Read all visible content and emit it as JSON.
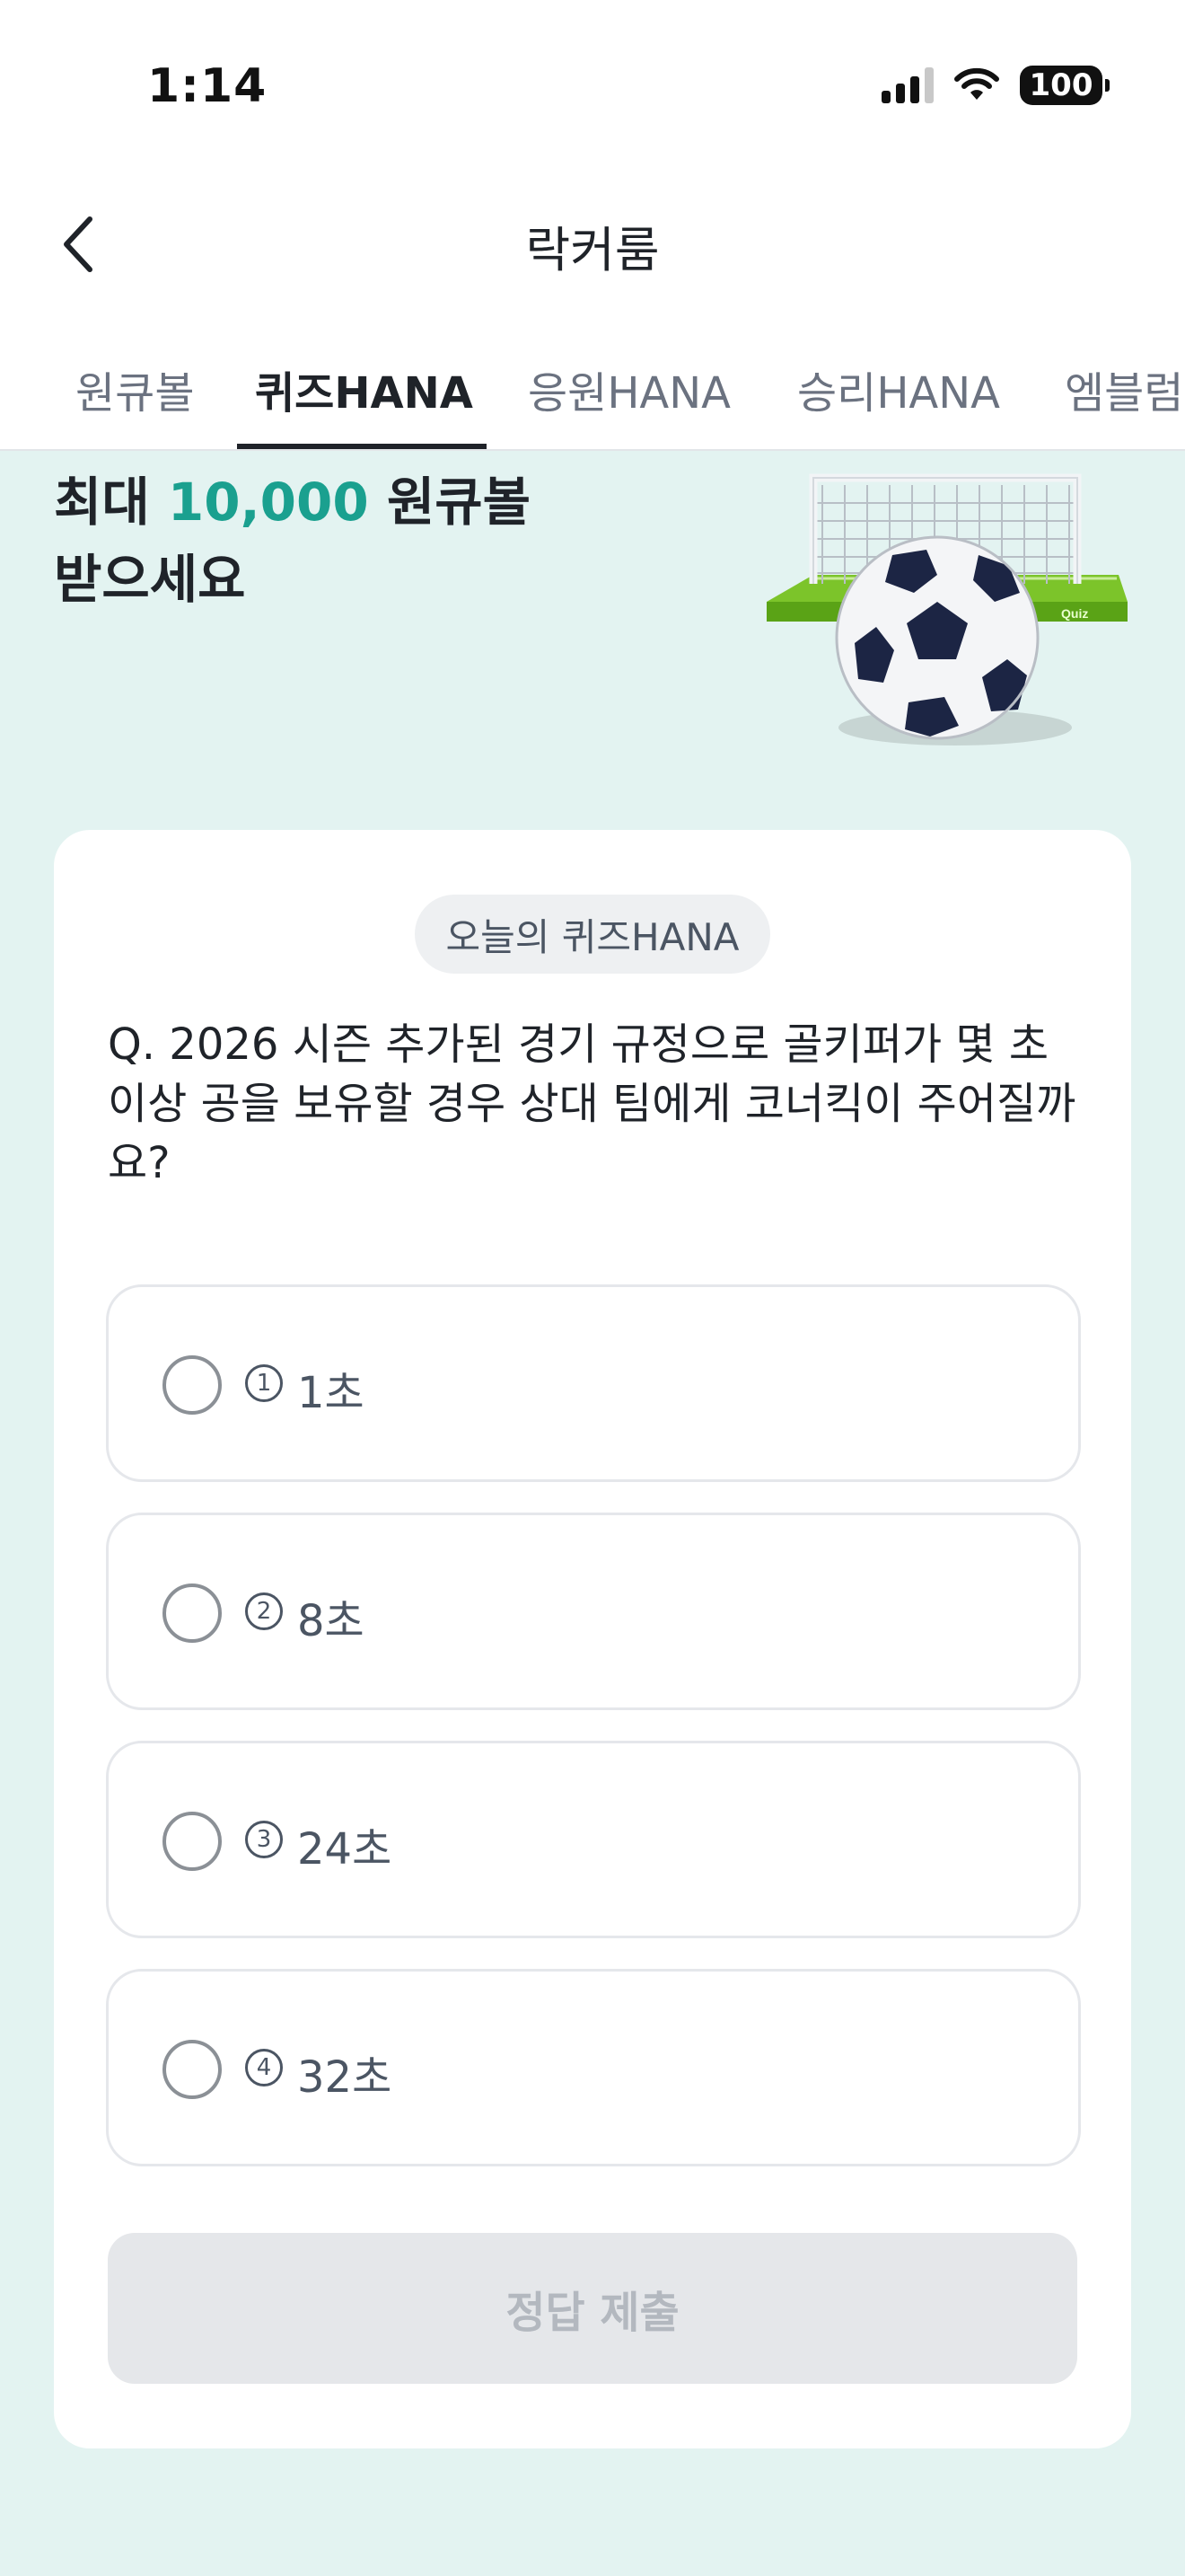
{
  "status_bar": {
    "time": "1:14",
    "battery": "100"
  },
  "header": {
    "title": "락커룸"
  },
  "tabs": [
    {
      "label": "원큐볼"
    },
    {
      "label": "퀴즈HANA"
    },
    {
      "label": "응원HANA"
    },
    {
      "label": "승리HANA"
    },
    {
      "label": "엠블럼"
    }
  ],
  "hero": {
    "prefix": "최대 ",
    "amount": "10,000",
    "suffix": " 원큐볼",
    "line2": "받으세요",
    "illustration_text": "Quiz"
  },
  "quiz": {
    "badge": "오늘의 퀴즈HANA",
    "question": "Q. 2026 시즌 추가된 경기 규정으로 골키퍼가 몇 초 이상 공을 보유할 경우 상대 팀에게 코너킥이 주어질까요?",
    "options": [
      {
        "num": "1",
        "label": "1초"
      },
      {
        "num": "2",
        "label": "8초"
      },
      {
        "num": "3",
        "label": "24초"
      },
      {
        "num": "4",
        "label": "32초"
      }
    ],
    "submit_label": "정답 제출"
  },
  "colors": {
    "accent": "#1aa08f",
    "background": "#e3f3f1"
  }
}
